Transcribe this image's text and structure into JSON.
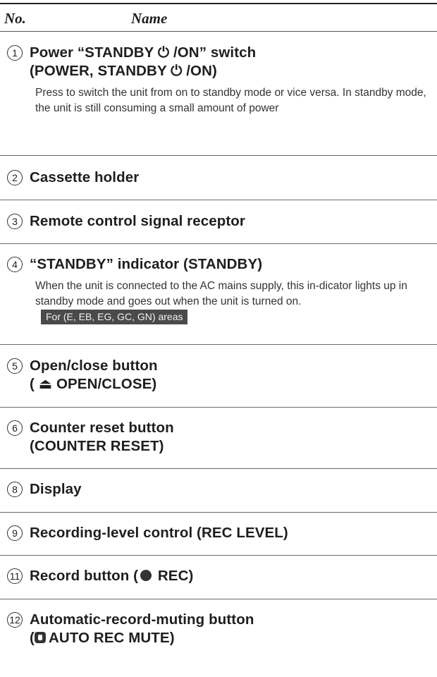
{
  "header": {
    "no": "No.",
    "name": "Name"
  },
  "entries": [
    {
      "num": "1",
      "title1": "Power “STANDBY ⏻ /ON” switch",
      "title2": "(POWER, STANDBY ⏻ /ON)",
      "desc": "Press to switch the unit from on to standby mode or vice versa. In standby mode, the unit is still consuming a small amount of power"
    },
    {
      "num": "2",
      "title1": "Cassette holder"
    },
    {
      "num": "3",
      "title1": "Remote control signal receptor"
    },
    {
      "num": "4",
      "title1": "“STANDBY” indicator (STANDBY)",
      "desc": "When the unit is connected to the AC mains supply, this in-dicator lights up in standby mode and goes out when the unit is turned on.",
      "note": "For (E, EB, EG, GC, GN) areas"
    },
    {
      "num": "5",
      "title1": "Open/close button",
      "title2": "( ⏏ OPEN/CLOSE)"
    },
    {
      "num": "6",
      "title1": "Counter reset button",
      "title2": "(COUNTER RESET)"
    },
    {
      "num": "8",
      "title1": "Display"
    },
    {
      "num": "9",
      "title1": "Recording-level control (REC LEVEL)"
    },
    {
      "num": "11",
      "title1": "Record button (",
      "title1_after": " REC)"
    },
    {
      "num": "12",
      "title1": "Automatic-record-muting button",
      "title2_prefix": "(",
      "title2": "AUTO REC MUTE)"
    }
  ]
}
